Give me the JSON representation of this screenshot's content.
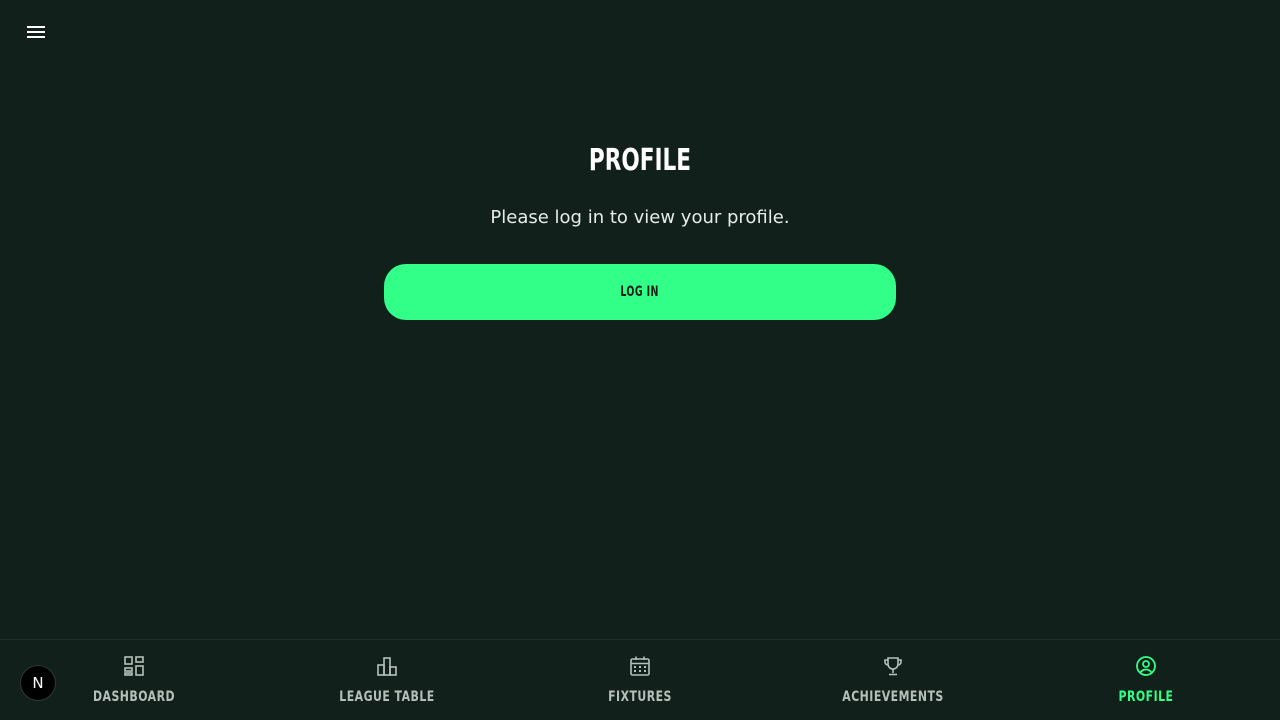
{
  "header": {
    "menu_icon": "hamburger-menu-icon"
  },
  "main": {
    "title": "PROFILE",
    "message": "Please log in to view your profile.",
    "login_label": "LOG IN"
  },
  "nav": {
    "items": [
      {
        "label": "DASHBOARD",
        "icon": "dashboard-icon",
        "active": false
      },
      {
        "label": "LEAGUE TABLE",
        "icon": "bar-chart-icon",
        "active": false
      },
      {
        "label": "FIXTURES",
        "icon": "calendar-icon",
        "active": false
      },
      {
        "label": "ACHIEVEMENTS",
        "icon": "trophy-icon",
        "active": false
      },
      {
        "label": "PROFILE",
        "icon": "user-circle-icon",
        "active": true
      }
    ]
  },
  "badge": {
    "letter": "N"
  },
  "colors": {
    "background": "#11201a",
    "accent": "#31ff88",
    "inactive": "#b5c0ba"
  }
}
